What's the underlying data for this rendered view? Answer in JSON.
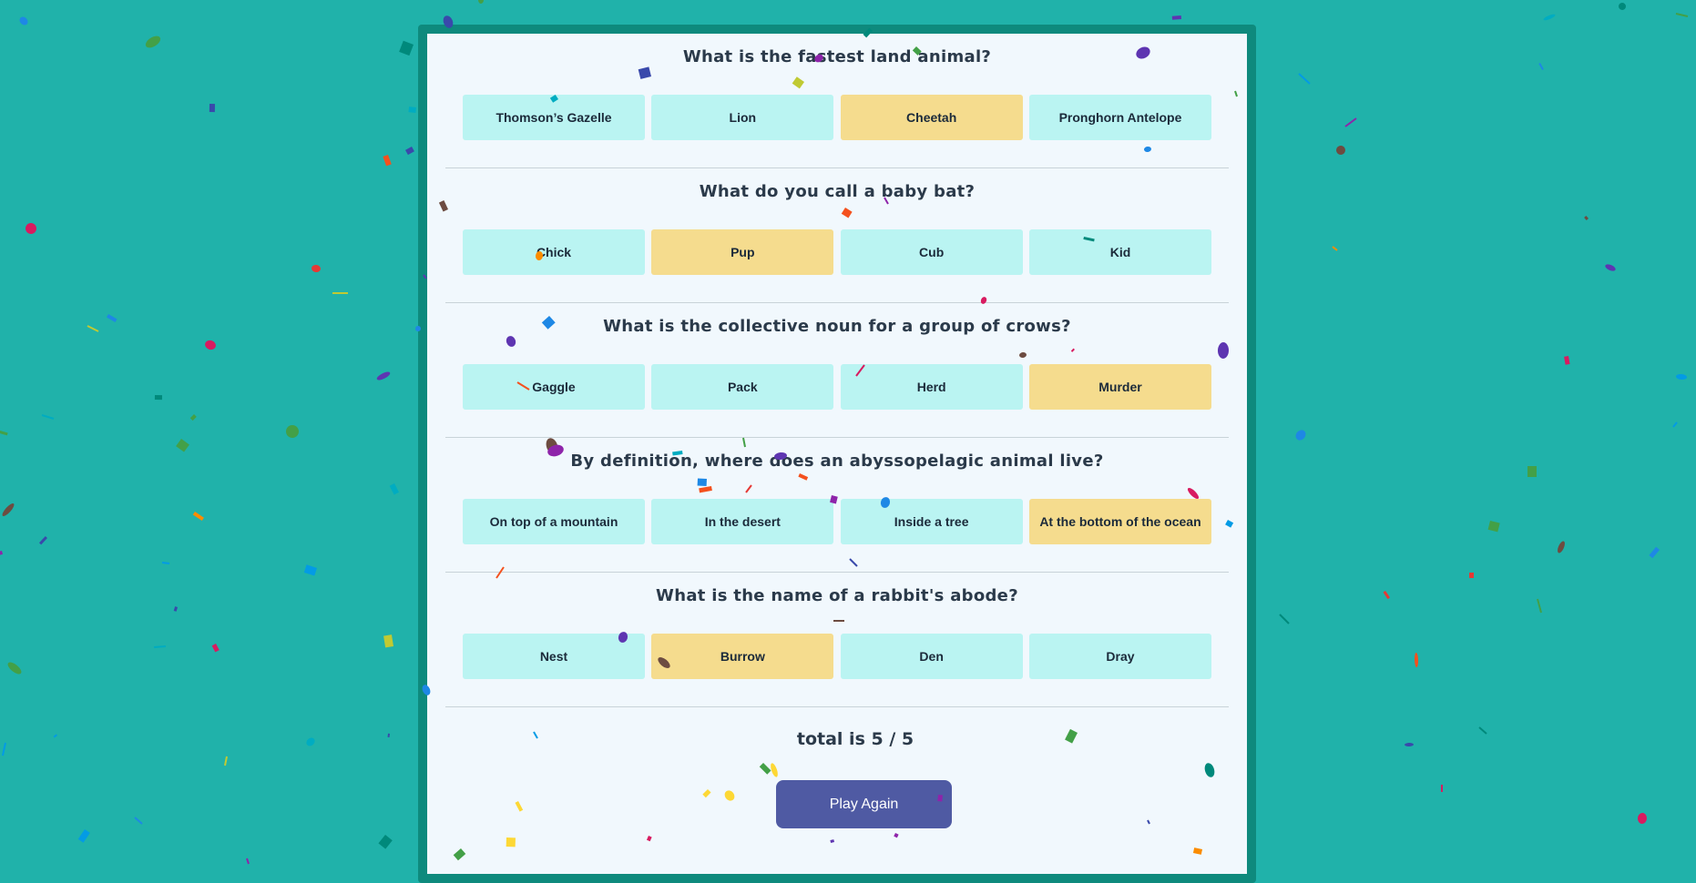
{
  "quiz": {
    "questions": [
      {
        "text": "What is the fastest land animal?",
        "options": [
          "Thomson’s Gazelle",
          "Lion",
          "Cheetah",
          "Pronghorn Antelope"
        ],
        "selected_index": 2
      },
      {
        "text": "What do you call a baby bat?",
        "options": [
          "Chick",
          "Pup",
          "Cub",
          "Kid"
        ],
        "selected_index": 1
      },
      {
        "text": "What is the collective noun for a group of crows?",
        "options": [
          "Gaggle",
          "Pack",
          "Herd",
          "Murder"
        ],
        "selected_index": 3
      },
      {
        "text": "By definition, where does an abyssopelagic animal live?",
        "options": [
          "On top of a mountain",
          "In the desert",
          "Inside a tree",
          "At the bottom of the ocean"
        ],
        "selected_index": 3
      },
      {
        "text": "What is the name of a rabbit's abode?",
        "options": [
          "Nest",
          "Burrow",
          "Den",
          "Dray"
        ],
        "selected_index": 1
      }
    ],
    "total_text": "total is 5 / 5",
    "play_again_label": "Play Again"
  },
  "colors": {
    "background": "#20b2aa",
    "frame": "#0e8a7d",
    "card": "#f1f8fd",
    "option_default": "#baf4f2",
    "option_selected": "#f5dc8e",
    "button": "#4f5aa3"
  },
  "decoration": "confetti"
}
